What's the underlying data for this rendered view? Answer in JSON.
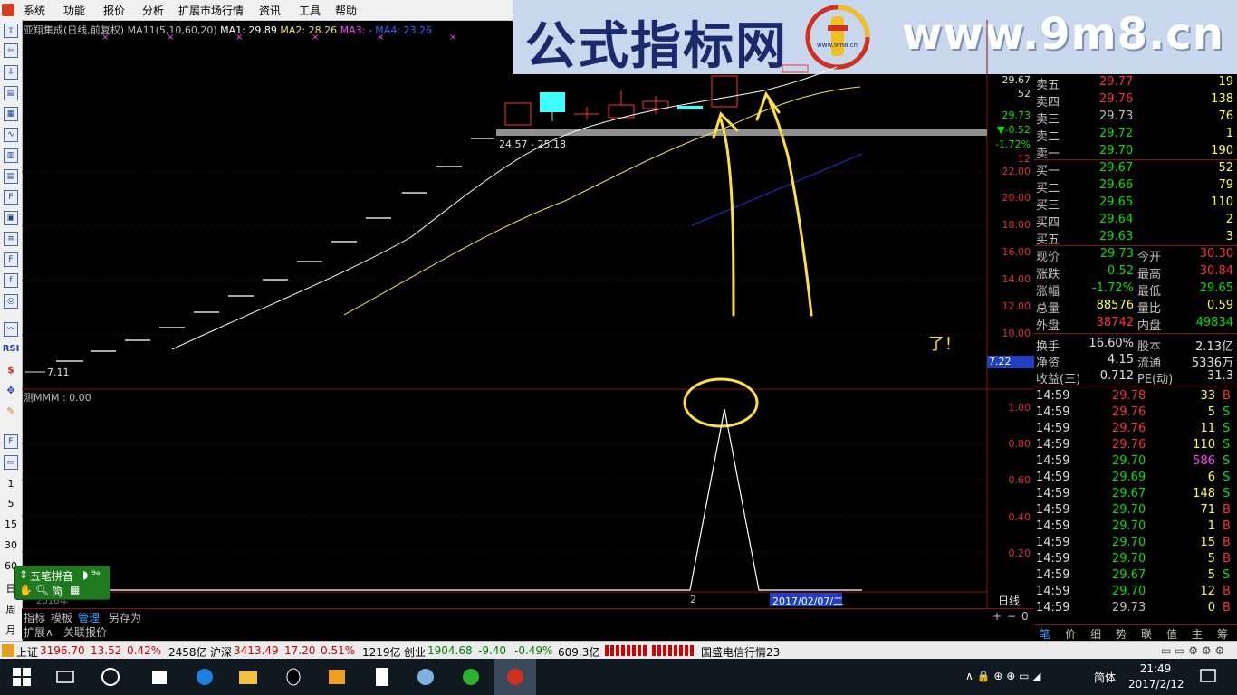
{
  "menu": {
    "items": [
      "系统",
      "功能",
      "报价",
      "分析",
      "扩展市场行情",
      "资讯",
      "工具",
      "帮助"
    ]
  },
  "banner": {
    "title": "公式指标网",
    "url": "www.9m8.cn",
    "logo_small": "www.9m8.cn"
  },
  "chart": {
    "legend_name": "亚翔集成(日线,前复权)",
    "legend_ma": "MA11(5,10,60,20)",
    "ma1": "MA1: 29.89",
    "ma2": "MA2: 28.26",
    "ma3": "MA3: -",
    "ma4": "MA4: 23.26",
    "range_label": "24.57 - 25.18",
    "low_label": "7.11",
    "annotation": "了！",
    "axis": [
      "29.67",
      "52",
      "29.73",
      "-0.52",
      "-1.72%",
      "12",
      "22.00",
      "20.00",
      "18.00",
      "16.00",
      "14.00",
      "12.00",
      "10.00"
    ],
    "axis_highlight": "7.22",
    "lower_legend": "测MMM : 0.00",
    "lower_axis": [
      "1.00",
      "0.80",
      "0.60",
      "0.40",
      "0.20"
    ],
    "date_left": "2016年",
    "date_mark": "2",
    "date_highlight": "2017/02/07/二",
    "period": "日线",
    "zoom_controls": [
      "+",
      "−",
      "0"
    ]
  },
  "left_toolbar": {
    "numbers": [
      "1",
      "5",
      "15",
      "30",
      "60"
    ],
    "labels": [
      "日",
      "周",
      "月"
    ],
    "rsi": "RSI"
  },
  "ime": {
    "name": "五笔拼音",
    "mode": "简",
    "extra": "◗ ⁹ᵉ"
  },
  "quote": {
    "asks": [
      {
        "label": "卖五",
        "price": "29.77",
        "vol": "19"
      },
      {
        "label": "卖四",
        "price": "29.76",
        "vol": "138"
      },
      {
        "label": "卖三",
        "price": "29.73",
        "vol": "76"
      },
      {
        "label": "卖二",
        "price": "29.72",
        "vol": "1"
      },
      {
        "label": "卖一",
        "price": "29.70",
        "vol": "190"
      }
    ],
    "bids": [
      {
        "label": "买一",
        "price": "29.67",
        "vol": "52"
      },
      {
        "label": "买二",
        "price": "29.66",
        "vol": "79"
      },
      {
        "label": "买三",
        "price": "29.65",
        "vol": "110"
      },
      {
        "label": "买四",
        "price": "29.64",
        "vol": "2"
      },
      {
        "label": "买五",
        "price": "29.63",
        "vol": "3"
      }
    ],
    "stats": [
      {
        "l1": "现价",
        "v1": "29.73",
        "l2": "今开",
        "v2": "30.30"
      },
      {
        "l1": "涨跌",
        "v1": "-0.52",
        "l2": "最高",
        "v2": "30.84"
      },
      {
        "l1": "涨幅",
        "v1": "-1.72%",
        "l2": "最低",
        "v2": "29.65"
      },
      {
        "l1": "总量",
        "v1": "88576",
        "l2": "量比",
        "v2": "0.59"
      },
      {
        "l1": "外盘",
        "v1": "38742",
        "l2": "内盘",
        "v2": "49834"
      }
    ],
    "fin": [
      {
        "l1": "换手",
        "v1": "16.60%",
        "l2": "股本",
        "v2": "2.13亿"
      },
      {
        "l1": "净资",
        "v1": "4.15",
        "l2": "流通",
        "v2": "5336万"
      },
      {
        "l1": "收益(三)",
        "v1": "0.712",
        "l2": "PE(动)",
        "v2": "31.3"
      }
    ],
    "ticks": [
      {
        "t": "14:59",
        "p": "29.78",
        "v": "33",
        "s": "B"
      },
      {
        "t": "14:59",
        "p": "29.76",
        "v": "5",
        "s": "S"
      },
      {
        "t": "14:59",
        "p": "29.76",
        "v": "11",
        "s": "S"
      },
      {
        "t": "14:59",
        "p": "29.76",
        "v": "110",
        "s": "S"
      },
      {
        "t": "14:59",
        "p": "29.70",
        "v": "586",
        "s": "S"
      },
      {
        "t": "14:59",
        "p": "29.69",
        "v": "6",
        "s": "S"
      },
      {
        "t": "14:59",
        "p": "29.67",
        "v": "148",
        "s": "S"
      },
      {
        "t": "14:59",
        "p": "29.70",
        "v": "71",
        "s": "B"
      },
      {
        "t": "14:59",
        "p": "29.70",
        "v": "1",
        "s": "B"
      },
      {
        "t": "14:59",
        "p": "29.70",
        "v": "15",
        "s": "B"
      },
      {
        "t": "14:59",
        "p": "29.70",
        "v": "5",
        "s": "B"
      },
      {
        "t": "14:59",
        "p": "29.67",
        "v": "5",
        "s": "S"
      },
      {
        "t": "14:59",
        "p": "29.70",
        "v": "12",
        "s": "B"
      },
      {
        "t": "14:59",
        "p": "29.73",
        "v": "0",
        "s": "B"
      }
    ],
    "tabs": [
      "笔",
      "价",
      "细",
      "势",
      "联",
      "值",
      "主",
      "筹"
    ]
  },
  "bottom_tabs": {
    "row1": [
      "指标",
      "模板",
      "管理",
      "另存为"
    ],
    "row2": [
      "扩展∧",
      "关联报价"
    ]
  },
  "status": {
    "sh_label": "上证",
    "sh_val": "3196.70",
    "sh_chg": "13.52",
    "sh_pct": "0.42%",
    "sh_amt": "2458亿",
    "hs_label": "沪深",
    "hs_val": "3413.49",
    "hs_chg": "17.20",
    "hs_pct": "0.51%",
    "hs_amt": "1219亿",
    "cy_label": "创业",
    "cy_val": "1904.68",
    "cy_chg": "-9.40",
    "cy_pct": "-0.49%",
    "cy_amt": "609.3亿",
    "news": "国盛电信行情23"
  },
  "taskbar": {
    "time": "21:49",
    "date": "2017/2/12",
    "ime": "简体"
  },
  "colors": {
    "up": "#ff3030",
    "down": "#00e000",
    "yellow": "#ffff40",
    "cyan": "#40ffff",
    "axis": "#8a1010",
    "highlight": "#2040c0"
  }
}
